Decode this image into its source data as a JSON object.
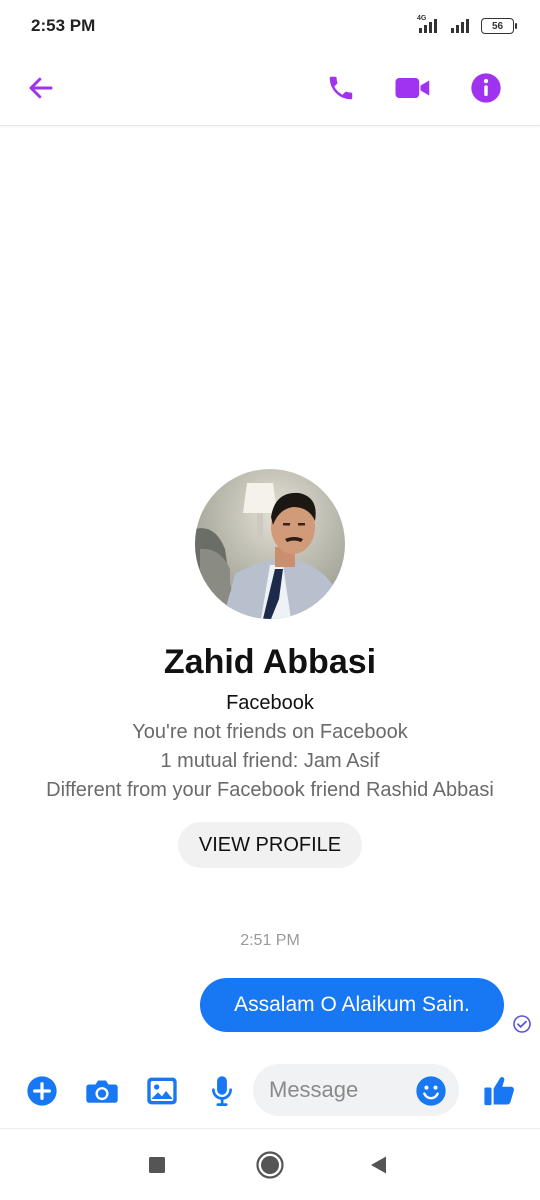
{
  "status_bar": {
    "time": "2:53 PM",
    "network_label": "4G",
    "battery_level": "56"
  },
  "header": {
    "back_icon": "arrow-left-icon",
    "call_icon": "phone-icon",
    "video_icon": "video-camera-icon",
    "info_icon": "info-icon",
    "accent_color": "#a033f0"
  },
  "profile": {
    "name": "Zahid Abbasi",
    "source": "Facebook",
    "friend_status": "You're not friends on Facebook",
    "mutual_friends": "1 mutual friend: Jam Asif",
    "different_from": "Different from your Facebook friend Rashid Abbasi",
    "view_profile_label": "VIEW PROFILE"
  },
  "messages": {
    "timestamp": "2:51 PM",
    "items": [
      {
        "text": "Assalam O Alaikum Sain.",
        "outgoing": true,
        "status": "sent"
      }
    ],
    "bubble_color": "#1877f2"
  },
  "composer": {
    "placeholder": "Message",
    "icons": [
      "plus-icon",
      "camera-icon",
      "gallery-icon",
      "microphone-icon",
      "emoji-icon",
      "thumbs-up-icon"
    ],
    "icon_color": "#1877f2"
  },
  "navbar": {
    "icons": [
      "recents-square-icon",
      "home-circle-icon",
      "back-triangle-icon"
    ]
  }
}
